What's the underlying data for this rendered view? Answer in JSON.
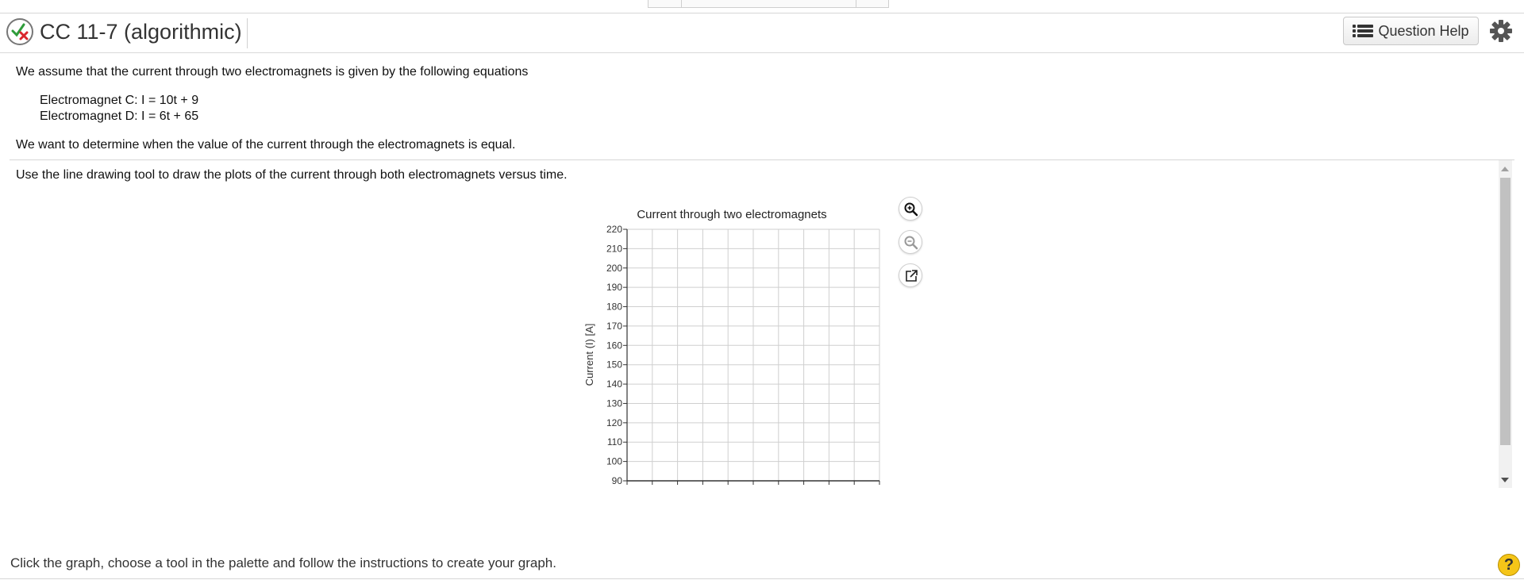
{
  "header": {
    "title": "CC 11-7 (algorithmic)",
    "help_label": "Question Help"
  },
  "question": {
    "intro": "We assume that the current through two electromagnets is given by the following equations",
    "equations": [
      "Electromagnet C: I = 10t + 9",
      "Electromagnet D: I = 6t + 65"
    ],
    "goal": "We want to determine when the value of the current through the electromagnets is equal.",
    "instruction": "Use the line drawing tool to draw the plots of the current through both electromagnets versus time."
  },
  "footer": {
    "text": "Click the graph, choose a tool in the palette and follow the instructions to create your graph.",
    "help_glyph": "?"
  },
  "colors": {
    "accent_green": "#2e9c3a",
    "accent_red": "#d9262c",
    "help_yellow": "#f5c518"
  },
  "chart_data": {
    "type": "line",
    "title": "Current through two electromagnets",
    "ylabel": "Current (I) [A]",
    "xlabel": "",
    "ylim": [
      90,
      220
    ],
    "y_ticks": [
      220,
      210,
      200,
      190,
      180,
      170,
      160,
      150,
      140,
      130,
      120,
      110,
      100,
      90
    ],
    "x_gridlines": 10,
    "grid": true,
    "series": []
  }
}
